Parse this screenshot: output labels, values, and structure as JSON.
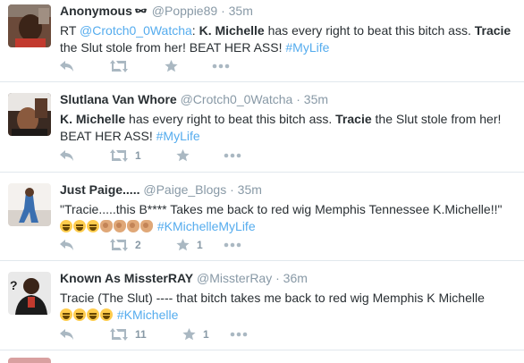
{
  "tweets": [
    {
      "fullname": "Anonymous",
      "handle": "@Poppie89",
      "time": "35m",
      "has_mask_icon": true,
      "segments": [
        {
          "t": "RT "
        },
        {
          "t": "@Crotch0_0Watcha",
          "style": "link"
        },
        {
          "t": ": "
        },
        {
          "t": "K. Michelle",
          "style": "bold"
        },
        {
          "t": " has every right to beat this bitch ass. "
        },
        {
          "t": "Tracie",
          "style": "bold"
        },
        {
          "t": " the Slut stole from her! BEAT HER ASS! "
        },
        {
          "t": "#MyLife",
          "style": "link"
        }
      ],
      "retweets": "",
      "favorites": ""
    },
    {
      "fullname": "Slutlana Van Whore",
      "handle": "@Crotch0_0Watcha",
      "time": "35m",
      "segments": [
        {
          "t": "K. Michelle",
          "style": "bold"
        },
        {
          "t": " has every right to beat this bitch ass. "
        },
        {
          "t": "Tracie",
          "style": "bold"
        },
        {
          "t": " the Slut stole from her! BEAT HER ASS! "
        },
        {
          "t": "#MyLife",
          "style": "link"
        }
      ],
      "retweets": "1",
      "favorites": ""
    },
    {
      "fullname": "Just Paige.....",
      "handle": "@Paige_Blogs",
      "time": "35m",
      "segments": [
        {
          "t": "\"Tracie.....this B**** Takes me back to red wig Memphis Tennessee K.Michelle!!\""
        },
        {
          "br": true
        },
        {
          "emoji": "laugh"
        },
        {
          "emoji": "laugh"
        },
        {
          "emoji": "laugh"
        },
        {
          "emoji": "clap"
        },
        {
          "emoji": "clap"
        },
        {
          "emoji": "clap"
        },
        {
          "emoji": "clap"
        },
        {
          "t": " "
        },
        {
          "t": "#KMichelleMyLife",
          "style": "link"
        }
      ],
      "retweets": "2",
      "favorites": "1"
    },
    {
      "fullname": "Known As MissterRAY",
      "handle": "@MissterRay",
      "time": "36m",
      "segments": [
        {
          "t": "Tracie (The Slut) ---- that bitch takes me back to red wig Memphis K Michelle"
        },
        {
          "br": true
        },
        {
          "emoji": "laugh"
        },
        {
          "emoji": "laugh"
        },
        {
          "emoji": "laugh"
        },
        {
          "emoji": "laugh"
        },
        {
          "t": " "
        },
        {
          "t": "#KMichelle",
          "style": "link"
        }
      ],
      "retweets": "11",
      "favorites": "1"
    }
  ],
  "icons": {
    "reply": "reply-icon",
    "retweet": "retweet-icon",
    "favorite": "star-icon",
    "more": "more-icon"
  },
  "colors": {
    "link": "#55acee",
    "meta": "#8899a6",
    "text": "#292f33",
    "divider": "#e1e8ed"
  }
}
